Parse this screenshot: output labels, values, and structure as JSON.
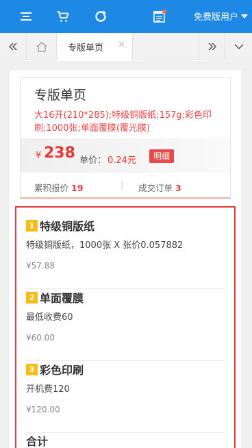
{
  "topbar": {
    "icons": [
      "menu-icon",
      "cart-icon",
      "refresh-icon",
      "calendar-notification-icon"
    ],
    "user_label": "免费版用户"
  },
  "tabs": {
    "active_label": "专版单页",
    "close_glyph": "×"
  },
  "product": {
    "title": "专版单页",
    "spec": "大16开(210*285);特级铜版纸;157g;彩色印刷;1000张;单面覆膜(覆光膜)",
    "currency": "¥",
    "price": "238",
    "unit_price_label": "单价：",
    "unit_price_value": "0.24元",
    "detail_button": "明细",
    "quote_label": "累积报价",
    "quote_count": "19",
    "separator": "|",
    "order_label": "成交订单",
    "order_count": "3"
  },
  "breakdown": {
    "items": [
      {
        "index": "1",
        "name": "特级铜版纸",
        "desc": "特级铜版纸，1000张 X 张价0.057882",
        "price": "¥57.88"
      },
      {
        "index": "2",
        "name": "单面覆膜",
        "desc": "最低收费60",
        "price": "¥60.00"
      },
      {
        "index": "3",
        "name": "彩色印刷",
        "desc": "开机费120",
        "price": "¥120.00"
      }
    ],
    "total_label": "合计"
  },
  "colors": {
    "topbar": "#1e88e5",
    "accent_red": "#e53935",
    "badge_yellow": "#fbbc1a"
  }
}
